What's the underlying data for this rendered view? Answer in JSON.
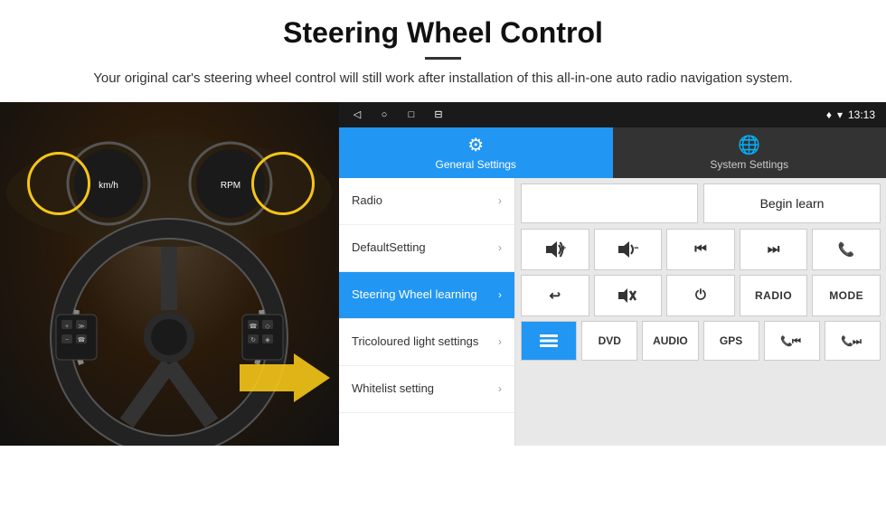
{
  "header": {
    "title": "Steering Wheel Control",
    "divider": true,
    "subtitle": "Your original car's steering wheel control will still work after installation of this all-in-one auto radio navigation system."
  },
  "status_bar": {
    "icons": [
      "◁",
      "○",
      "□",
      "⊟"
    ],
    "right_icons": [
      "♦",
      "▾"
    ],
    "time": "13:13"
  },
  "tabs": {
    "general": {
      "label": "General Settings",
      "icon": "⚙"
    },
    "system": {
      "label": "System Settings",
      "icon": "🌐"
    }
  },
  "menu": {
    "items": [
      {
        "label": "Radio",
        "active": false
      },
      {
        "label": "DefaultSetting",
        "active": false
      },
      {
        "label": "Steering Wheel learning",
        "active": true
      },
      {
        "label": "Tricoloured light settings",
        "active": false
      },
      {
        "label": "Whitelist setting",
        "active": false
      }
    ]
  },
  "content": {
    "begin_learn": "Begin learn",
    "buttons_row1": [
      {
        "label": "🔊+",
        "type": "icon"
      },
      {
        "label": "🔊−",
        "type": "icon"
      },
      {
        "label": "⏮",
        "type": "icon"
      },
      {
        "label": "⏭",
        "type": "icon"
      },
      {
        "label": "📞",
        "type": "icon"
      }
    ],
    "buttons_row2": [
      {
        "label": "↩",
        "type": "icon"
      },
      {
        "label": "🔇×",
        "type": "icon"
      },
      {
        "label": "⏻",
        "type": "icon"
      },
      {
        "label": "RADIO",
        "type": "text"
      },
      {
        "label": "MODE",
        "type": "text"
      }
    ],
    "buttons_row3": [
      {
        "label": "DVD",
        "type": "text"
      },
      {
        "label": "AUDIO",
        "type": "text"
      },
      {
        "label": "GPS",
        "type": "text"
      },
      {
        "label": "📞⏮",
        "type": "icon"
      },
      {
        "label": "📞⏭",
        "type": "icon"
      }
    ],
    "special_btn": "≡"
  }
}
